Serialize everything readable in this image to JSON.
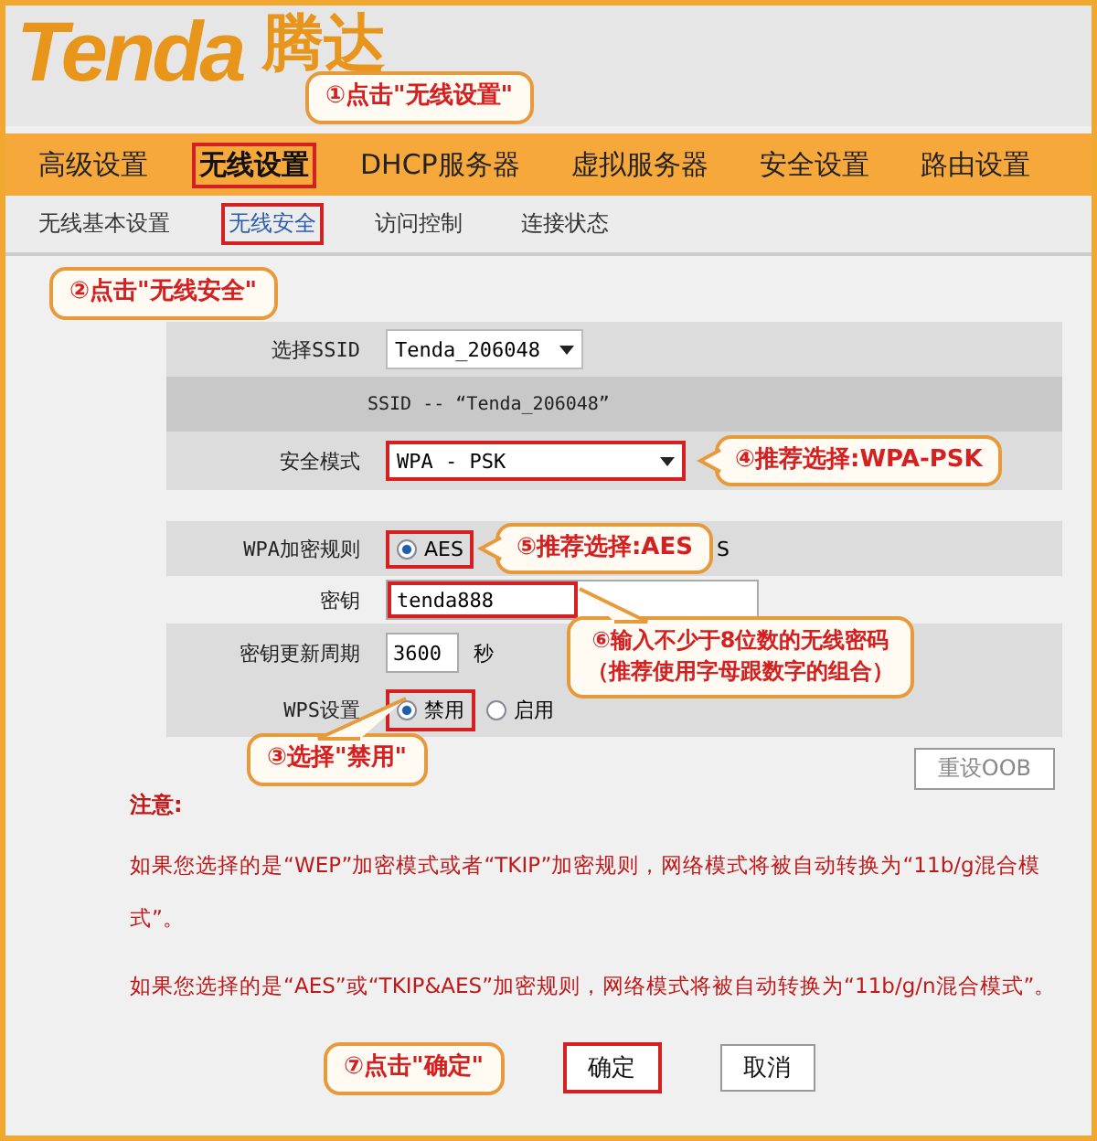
{
  "logo": {
    "brand": "Tenda",
    "native": "腾达"
  },
  "nav": [
    {
      "label": "高级设置",
      "selected": false,
      "highlighted": false
    },
    {
      "label": "无线设置",
      "selected": true,
      "highlighted": true
    },
    {
      "label": "DHCP服务器",
      "selected": false,
      "highlighted": false
    },
    {
      "label": "虚拟服务器",
      "selected": false,
      "highlighted": false
    },
    {
      "label": "安全设置",
      "selected": false,
      "highlighted": false
    },
    {
      "label": "路由设置",
      "selected": false,
      "highlighted": false
    }
  ],
  "subnav": [
    {
      "label": "无线基本设置",
      "selected": false,
      "highlighted": false
    },
    {
      "label": "无线安全",
      "selected": true,
      "highlighted": true
    },
    {
      "label": "访问控制",
      "selected": false,
      "highlighted": false
    },
    {
      "label": "连接状态",
      "selected": false,
      "highlighted": false
    }
  ],
  "callouts": {
    "nav": "①点击\"无线设置\"",
    "subnav": "②点击\"无线安全\"",
    "wps": "③选择\"禁用\"",
    "mode": "④推荐选择:WPA-PSK",
    "cipher": "⑤推荐选择:AES",
    "key": [
      "⑥输入不少于8位数的无线密码",
      "（推荐使用字母跟数字的组合）"
    ],
    "ok": "⑦点击\"确定\""
  },
  "form": {
    "ssid_label": "选择SSID",
    "ssid_value": "Tenda_206048",
    "ssid_caption": "SSID -- “Tenda_206048”",
    "mode_label": "安全模式",
    "mode_value": "WPA - PSK",
    "cipher_label": "WPA加密规则",
    "cipher_options": [
      {
        "label": "AES",
        "selected": true
      },
      {
        "label": "S"
      }
    ],
    "key_label": "密钥",
    "key_value": "tenda888",
    "renew_label": "密钥更新周期",
    "renew_value": "3600",
    "renew_unit": "秒",
    "wps_label": "WPS设置",
    "wps_options": [
      {
        "label": "禁用",
        "selected": true
      },
      {
        "label": "启用",
        "selected": false
      }
    ],
    "reset_button": "重设OOB"
  },
  "notes": {
    "title": "注意:",
    "paragraphs": [
      "如果您选择的是“WEP”加密模式或者“TKIP”加密规则，网络模式将被自动转换为“11b/g混合模式”。",
      "如果您选择的是“AES”或“TKIP&AES”加密规则，网络模式将被自动转换为“11b/g/n混合模式”。"
    ]
  },
  "buttons": [
    {
      "label": "确定",
      "highlighted": true
    },
    {
      "label": "取消",
      "highlighted": false
    }
  ]
}
